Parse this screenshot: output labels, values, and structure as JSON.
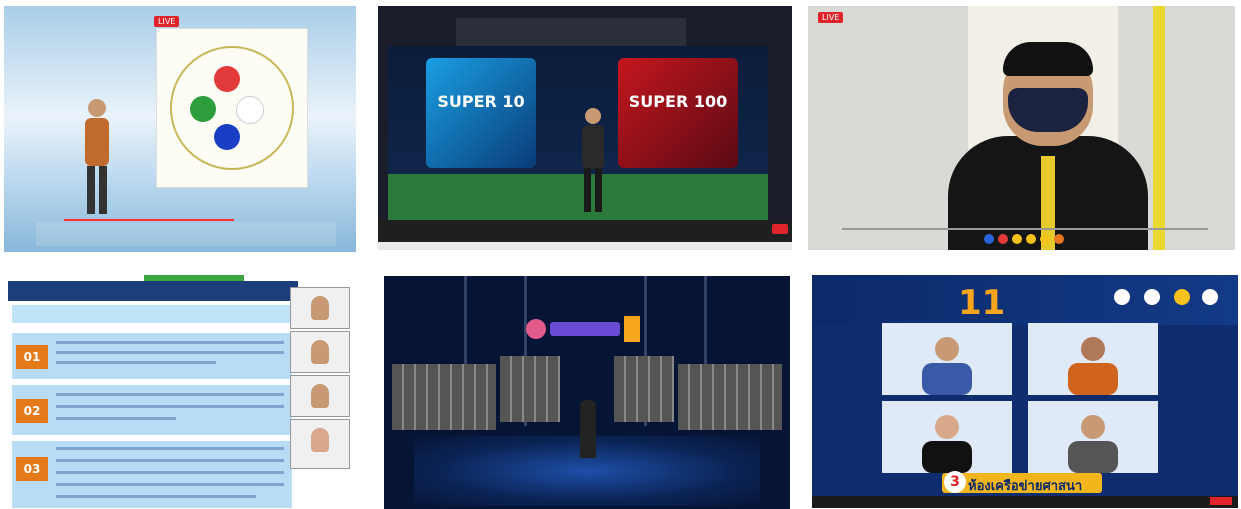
{
  "tiles": [
    {
      "id": "webinar-speaker",
      "live_badge": "LIVE",
      "viewers": "",
      "caption": ""
    },
    {
      "id": "studio-stage",
      "left_screen": "SUPER 10",
      "right_screen": "SUPER 100"
    },
    {
      "id": "masked-speaker"
    },
    {
      "id": "slide-presentation",
      "items": [
        "01",
        "02",
        "03"
      ]
    },
    {
      "id": "virtual-audience-stage"
    },
    {
      "id": "panel-meeting",
      "heading": "",
      "number": "11",
      "banner_number": "3",
      "banner_text": "ห้องเครือข่ายศาสนา"
    }
  ],
  "colors": {
    "live": "#e0242a",
    "zoom_toolbar": "#1f1f1f",
    "orange": "#e47a1a",
    "gold": "#f3b51c"
  }
}
